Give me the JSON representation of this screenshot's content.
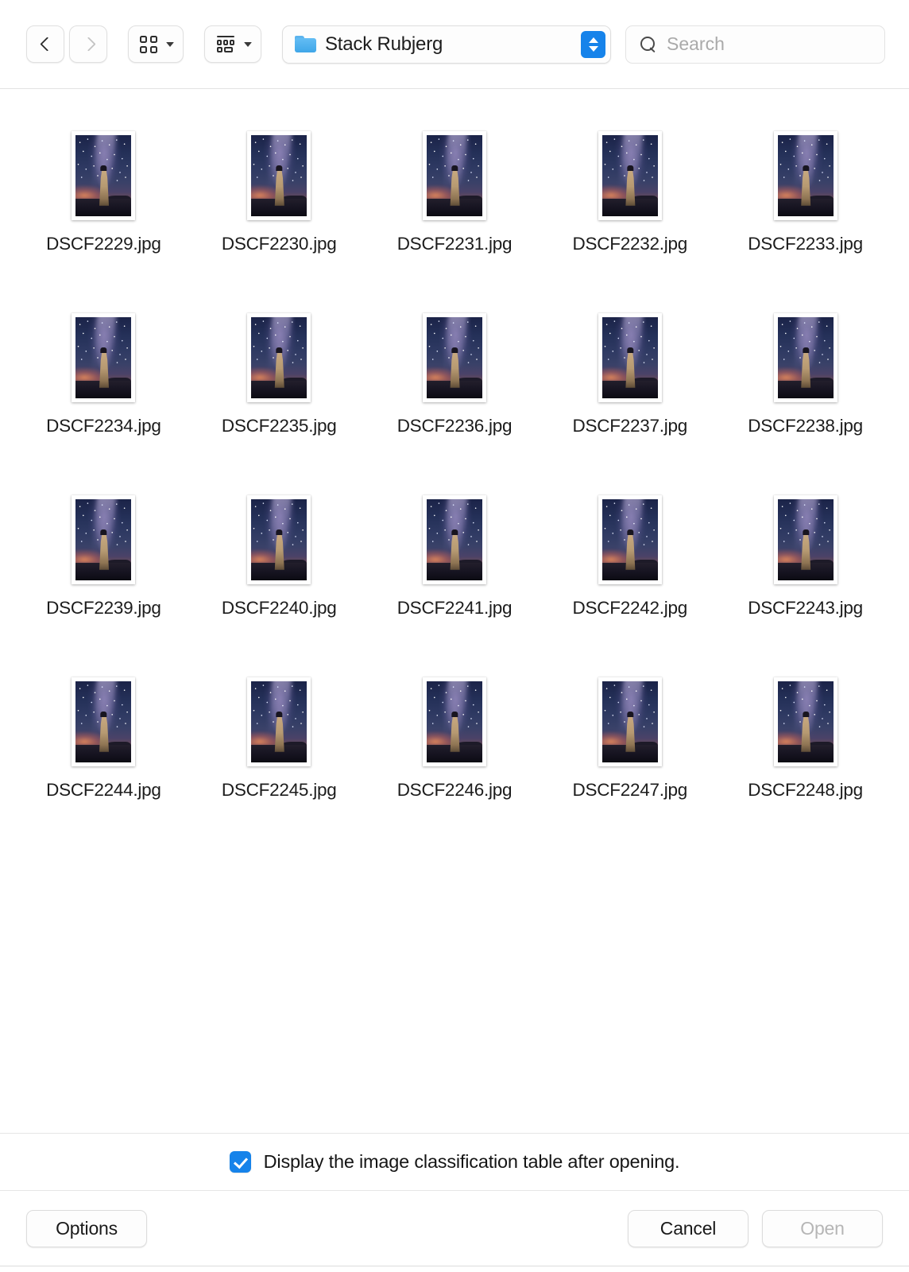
{
  "toolbar": {
    "back_button": {
      "name": "back",
      "icon": "chevron-left-icon",
      "enabled": true
    },
    "forward_button": {
      "name": "forward",
      "icon": "chevron-right-icon",
      "enabled": false
    },
    "view_mode_button": {
      "icon": "grid-view-icon",
      "menu_icon": "chevron-down-icon"
    },
    "group_by_button": {
      "icon": "group-by-icon",
      "menu_icon": "chevron-down-icon"
    },
    "path_popup": {
      "icon": "folder-icon",
      "label": "Stack Rubjerg",
      "stepper_icon": "up-down-stepper-icon"
    },
    "search": {
      "icon": "search-icon",
      "placeholder": "Search",
      "value": ""
    }
  },
  "files": [
    {
      "name": "DSCF2229.jpg"
    },
    {
      "name": "DSCF2230.jpg"
    },
    {
      "name": "DSCF2231.jpg"
    },
    {
      "name": "DSCF2232.jpg"
    },
    {
      "name": "DSCF2233.jpg"
    },
    {
      "name": "DSCF2234.jpg"
    },
    {
      "name": "DSCF2235.jpg"
    },
    {
      "name": "DSCF2236.jpg"
    },
    {
      "name": "DSCF2237.jpg"
    },
    {
      "name": "DSCF2238.jpg"
    },
    {
      "name": "DSCF2239.jpg"
    },
    {
      "name": "DSCF2240.jpg"
    },
    {
      "name": "DSCF2241.jpg"
    },
    {
      "name": "DSCF2242.jpg"
    },
    {
      "name": "DSCF2243.jpg"
    },
    {
      "name": "DSCF2244.jpg"
    },
    {
      "name": "DSCF2245.jpg"
    },
    {
      "name": "DSCF2246.jpg"
    },
    {
      "name": "DSCF2247.jpg"
    },
    {
      "name": "DSCF2248.jpg"
    }
  ],
  "accessory": {
    "checkbox_checked": true,
    "checkbox_label": "Display the image classification table after opening."
  },
  "buttons": {
    "options_label": "Options",
    "cancel_label": "Cancel",
    "open_label": "Open",
    "open_enabled": false
  },
  "colors": {
    "accent_blue": "#1683ea",
    "folder_blue": "#3fa6e8",
    "disabled_text": "#b6b6b6",
    "text": "#1c1c1c",
    "placeholder": "#aaaaaa",
    "background": "#ffffff",
    "separator": "#e6e6e6"
  }
}
